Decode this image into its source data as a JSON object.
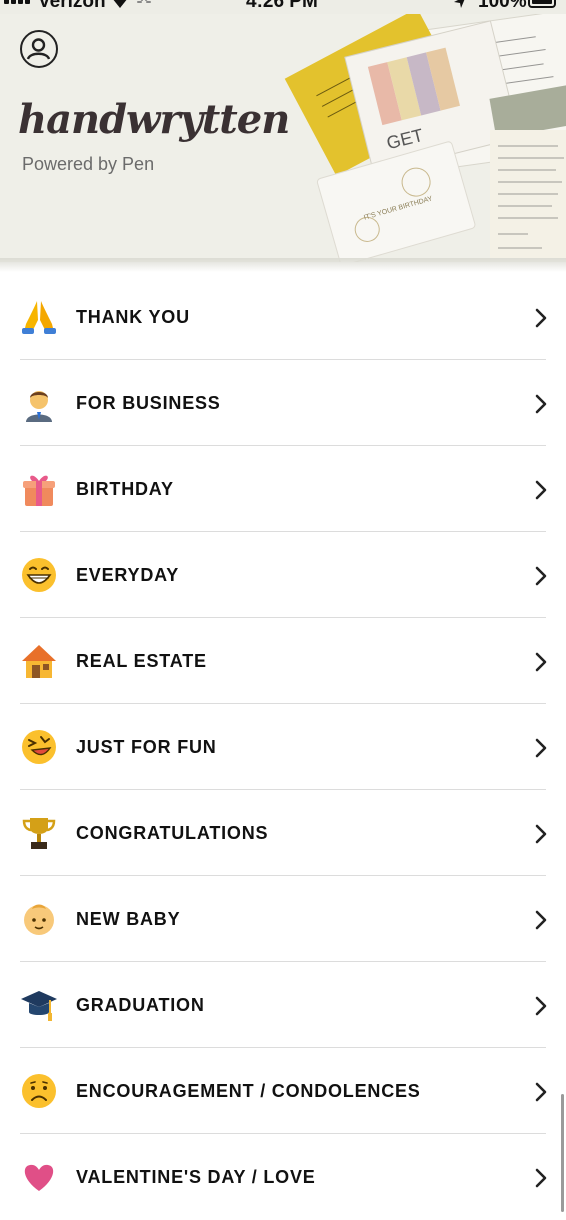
{
  "status_bar": {
    "carrier": "Verizon",
    "time": "4:26 PM",
    "battery": "100%"
  },
  "header": {
    "brand": "handwrytten",
    "tagline": "Powered by Pen",
    "card_text": "GET",
    "card_text_2": "IT'S YOUR BIRTHDAY"
  },
  "colors": {
    "header_bg": "#efefe8",
    "envelope_yellow": "#e3c22d",
    "divider": "#dcdcdc"
  },
  "categories": [
    {
      "label": "THANK YOU",
      "icon": "folded-hands-icon"
    },
    {
      "label": "FOR BUSINESS",
      "icon": "businessman-icon"
    },
    {
      "label": "BIRTHDAY",
      "icon": "gift-icon"
    },
    {
      "label": "EVERYDAY",
      "icon": "grinning-face-icon"
    },
    {
      "label": "REAL ESTATE",
      "icon": "house-icon"
    },
    {
      "label": "JUST FOR FUN",
      "icon": "laughing-face-icon"
    },
    {
      "label": "CONGRATULATIONS",
      "icon": "trophy-icon"
    },
    {
      "label": "NEW BABY",
      "icon": "baby-icon"
    },
    {
      "label": "GRADUATION",
      "icon": "graduation-cap-icon"
    },
    {
      "label": "ENCOURAGEMENT / CONDOLENCES",
      "icon": "sad-face-icon"
    },
    {
      "label": "VALENTINE'S DAY / LOVE",
      "icon": "heart-icon"
    }
  ]
}
